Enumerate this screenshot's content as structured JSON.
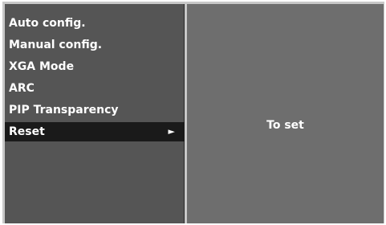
{
  "menu": {
    "items": [
      {
        "label": "Auto config.",
        "selected": false
      },
      {
        "label": "Manual config.",
        "selected": false
      },
      {
        "label": "XGA Mode",
        "selected": false
      },
      {
        "label": "ARC",
        "selected": false
      },
      {
        "label": "PIP Transparency",
        "selected": false
      },
      {
        "label": "Reset",
        "selected": true,
        "submenu_icon": "right-triangle-icon"
      }
    ]
  },
  "detail": {
    "text": "To set"
  },
  "colors": {
    "menu_background": "#555555",
    "detail_background": "#6e6e6e",
    "frame": "#c8c8c8",
    "selected_row": "#1a1a1a",
    "text": "#ffffff"
  }
}
